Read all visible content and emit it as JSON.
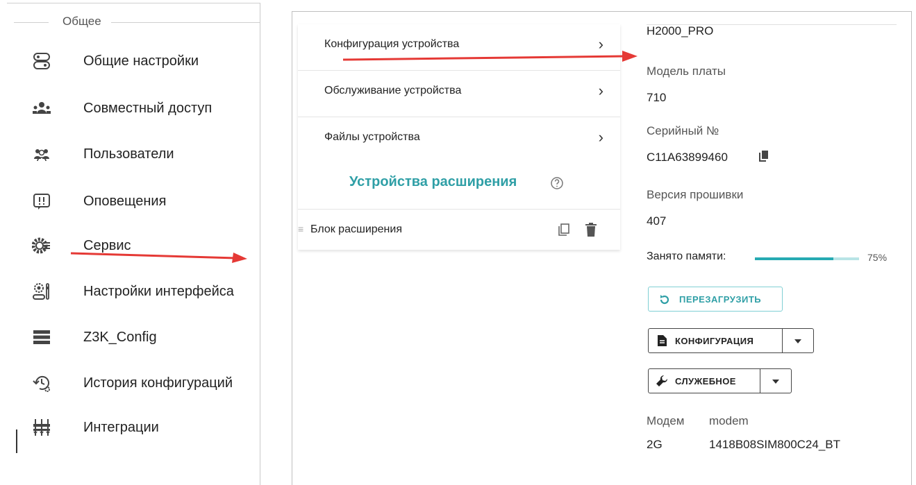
{
  "sidebar": {
    "group_title": "Общее",
    "items": [
      {
        "label": "Общие настройки",
        "icon": "toggle-settings-icon"
      },
      {
        "label": "Совместный доступ",
        "icon": "shared-access-icon"
      },
      {
        "label": "Пользователи",
        "icon": "users-icon"
      },
      {
        "label": "Оповещения",
        "icon": "notifications-icon"
      },
      {
        "label": "Сервис",
        "icon": "service-gear-icon"
      },
      {
        "label": "Настройки интерфейса",
        "icon": "interface-settings-icon"
      },
      {
        "label": "Z3K_Config",
        "icon": "server-stack-icon"
      },
      {
        "label": "История конфигураций",
        "icon": "history-icon"
      },
      {
        "label": "Интеграции",
        "icon": "integrations-icon"
      }
    ]
  },
  "config_menu": {
    "items": [
      {
        "label": "Конфигурация устройства",
        "chevron": "›"
      },
      {
        "label": "Обслуживание устройства",
        "chevron": "›"
      },
      {
        "label": "Файлы устройства",
        "chevron": "›"
      }
    ],
    "extensions_title": "Устройства расширения",
    "extension_items": [
      {
        "label": "Блок расширения",
        "drag_glyph": "≡"
      }
    ]
  },
  "device_info": {
    "device_name": "H2000_PRO",
    "board_model_label": "Модель платы",
    "board_model_value": "710",
    "serial_label": "Серийный №",
    "serial_value": "C11A63899460",
    "firmware_label": "Версия прошивки",
    "firmware_value": "407",
    "memory_label": "Занято памяти:",
    "memory_percent_text": "75%",
    "memory_fraction": 0.75,
    "reload_button": "ПЕРЕЗАГРУЗИТЬ",
    "configuration_button": "КОНФИГУРАЦИЯ",
    "service_button": "СЛУЖЕБНОЕ",
    "modem_label": "Модем",
    "modem_value": "modem",
    "modem_type": "2G",
    "modem_version": "1418B08SIM800C24_BT"
  },
  "colors": {
    "accent": "#2f9fa6",
    "annotation_arrow": "#e53935",
    "memory_fill": "#26aab2",
    "memory_track": "#b8e4e6"
  }
}
